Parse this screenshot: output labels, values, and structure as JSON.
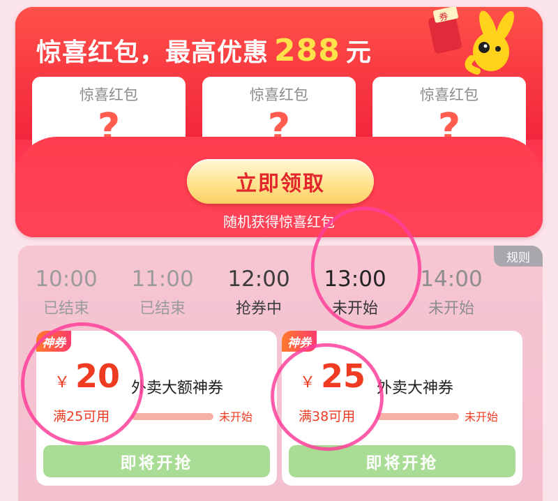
{
  "promo": {
    "title_prefix": "惊喜红包，最高优惠",
    "amount": "288",
    "unit": "元",
    "cards": [
      {
        "label": "惊喜红包",
        "mark": "?"
      },
      {
        "label": "惊喜红包",
        "mark": "?"
      },
      {
        "label": "惊喜红包",
        "mark": "?"
      }
    ],
    "claim_button": "立即领取",
    "claim_subtitle": "随机获得惊喜红包",
    "mascot_tag": "券"
  },
  "coupons_panel": {
    "rules": "规则",
    "slots": [
      {
        "time": "10:00",
        "status": "已结束"
      },
      {
        "time": "11:00",
        "status": "已结束"
      },
      {
        "time": "12:00",
        "status": "抢券中"
      },
      {
        "time": "13:00",
        "status": "未开始"
      },
      {
        "time": "14:00",
        "status": "未开始"
      }
    ],
    "coupons": [
      {
        "badge": "神券",
        "currency": "￥",
        "value": "20",
        "name": "外卖大额神券",
        "min_use": "满25可用",
        "status": "未开始",
        "button": "即将开抢"
      },
      {
        "badge": "神券",
        "currency": "￥",
        "value": "25",
        "name": "外卖大神券",
        "min_use": "满38可用",
        "status": "未开始",
        "button": "即将开抢"
      }
    ]
  },
  "colors": {
    "promo_red": "#f5243e",
    "gold": "#ffe14a",
    "coupon_red": "#ee3b22",
    "button_green": "#a9dc95",
    "annotation_pink": "#ff3f9a"
  }
}
